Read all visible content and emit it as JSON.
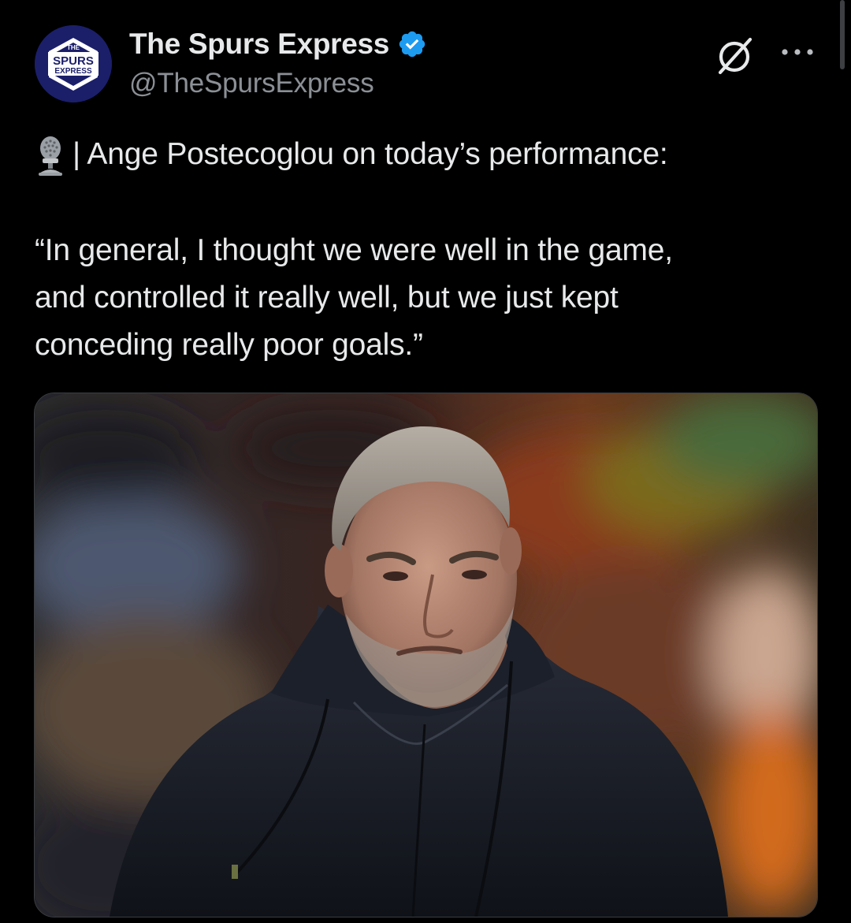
{
  "tweet": {
    "author": {
      "display_name": "The Spurs Express",
      "handle": "@TheSpursExpress",
      "verified": true,
      "avatar": {
        "small_text": "THE",
        "main_text": "SPURS",
        "sub_text": "EXPRESS",
        "background_color": "#1b1f6a",
        "badge_color": "#ffffff"
      }
    },
    "actions": {
      "grok_icon": "grok-icon",
      "more_icon": "more-icon"
    },
    "text": {
      "lead_icon": "studio-microphone-emoji",
      "lead": "| Ange Postecoglou on today’s performance:",
      "quote_lines": [
        "“In general, I thought we were well in the game,",
        "and controlled it really well, but we just kept",
        "conceding really poor goals.”"
      ]
    },
    "media": {
      "type": "photo",
      "subject": "man-in-dark-hooded-jacket"
    }
  },
  "colors": {
    "background": "#000000",
    "text_primary": "#e7e9ea",
    "text_secondary": "#8b9096",
    "verified_blue": "#1d9bf0"
  }
}
